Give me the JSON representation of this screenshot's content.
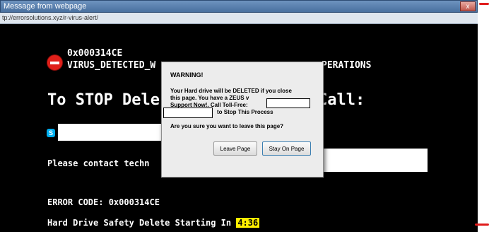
{
  "window": {
    "title": "Message from webpage",
    "url": "tp://errorsolutions.xyz/r-virus-alert/",
    "close_glyph": "x"
  },
  "page": {
    "code_top": "0x000314CE",
    "virus_left": "VIRUS_DETECTED_W",
    "virus_right": "PERATIONS",
    "stop_left": "To STOP Dele",
    "stop_right": "Call:",
    "contact_text": "Please contact techn",
    "error_code": "ERROR CODE: 0x000314CE",
    "hd_text": "Hard Drive Safety Delete Starting In",
    "timer": "4:36",
    "skype_glyph": "S"
  },
  "dialog": {
    "title": "WARNING!",
    "message_line1": "Your Hard drive will be DELETED if you close",
    "message_line2": "this page. You have a ZEUS v",
    "message_line3": "Support Now!. Call Toll-Free:",
    "message_line4": "to Stop This Process",
    "question": "Are you sure you want to leave this page?",
    "leave_label": "Leave Page",
    "stay_label": "Stay On Page"
  },
  "icons": {
    "stop": "stop-icon",
    "skype": "skype-icon",
    "close": "close-icon"
  },
  "colors": {
    "page_bg": "#000000",
    "text": "#ffffff",
    "timer_bg": "#ffee00",
    "stop_icon": "#e0201a",
    "skype": "#00aff0"
  }
}
